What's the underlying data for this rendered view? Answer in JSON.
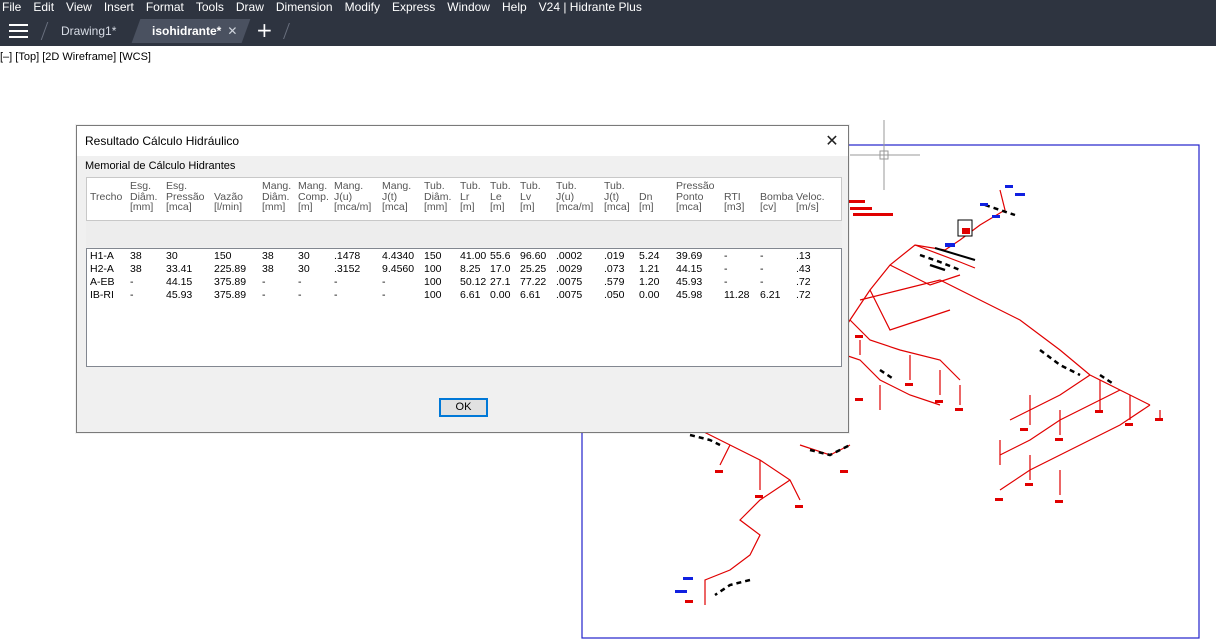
{
  "menu": [
    "File",
    "Edit",
    "View",
    "Insert",
    "Format",
    "Tools",
    "Draw",
    "Dimension",
    "Modify",
    "Express",
    "Window",
    "Help",
    "V24 | Hidrante Plus"
  ],
  "tabs": [
    {
      "label": "Drawing1*",
      "active": false
    },
    {
      "label": "isohidrante*",
      "active": true,
      "close": "✕"
    }
  ],
  "new_tab": "+",
  "viewport_label": "[–] [Top] [2D Wireframe] [WCS]",
  "dialog": {
    "title": "Resultado Cálculo Hidráulico",
    "close_glyph": "✕",
    "subtitle": "Memorial de Cálculo Hidrantes",
    "ok_label": "OK",
    "columns": [
      "\nTrecho",
      "Esg.\nDiâm.\n[mm]",
      "Esg.\nPressão\n[mca]",
      "\nVazão\n[l/min]",
      "Mang.\nDiâm.\n[mm]",
      "Mang.\nComp.\n[m]",
      "Mang.\nJ(u)\n[mca/m]",
      "Mang.\nJ(t)\n[mca]",
      "Tub.\nDiâm.\n[mm]",
      "Tub.\nLr\n[m]",
      "Tub.\nLe\n[m]",
      "Tub.\nLv\n[m]",
      "Tub.\nJ(u)\n[mca/m]",
      "Tub.\nJ(t)\n[mca]",
      "\nDn\n[m]",
      "Pressão\nPonto\n[mca]",
      "\nRTI\n[m3]",
      "\nBomba\n[cv]",
      "\nVeloc.\n[m/s]"
    ],
    "rows": [
      [
        "H1-A",
        "38",
        "30",
        "150",
        "38",
        "30",
        ".1478",
        "4.4340",
        "150",
        "41.00",
        "55.6",
        "96.60",
        ".0002",
        ".019",
        "5.24",
        "39.69",
        "-",
        "-",
        ".13"
      ],
      [
        "H2-A",
        "38",
        "33.41",
        "225.89",
        "38",
        "30",
        ".3152",
        "9.4560",
        "100",
        "8.25",
        "17.0",
        "25.25",
        ".0029",
        ".073",
        "1.21",
        "44.15",
        "-",
        "-",
        ".43"
      ],
      [
        "A-EB",
        "-",
        "44.15",
        "375.89",
        "-",
        "-",
        "-",
        "-",
        "100",
        "50.12",
        "27.1",
        "77.22",
        ".0075",
        ".579",
        "1.20",
        "45.93",
        "-",
        "-",
        ".72"
      ],
      [
        "IB-RI",
        "-",
        "45.93",
        "375.89",
        "-",
        "-",
        "-",
        "-",
        "100",
        "6.61",
        "0.00",
        "6.61",
        ".0075",
        ".050",
        "0.00",
        "45.98",
        "11.28",
        "6.21",
        ".72"
      ]
    ]
  },
  "colors": {
    "chrome": "#2e3440",
    "pipe": "#e00000",
    "frame": "#2222cc",
    "accent_blue": "#1020e0"
  }
}
